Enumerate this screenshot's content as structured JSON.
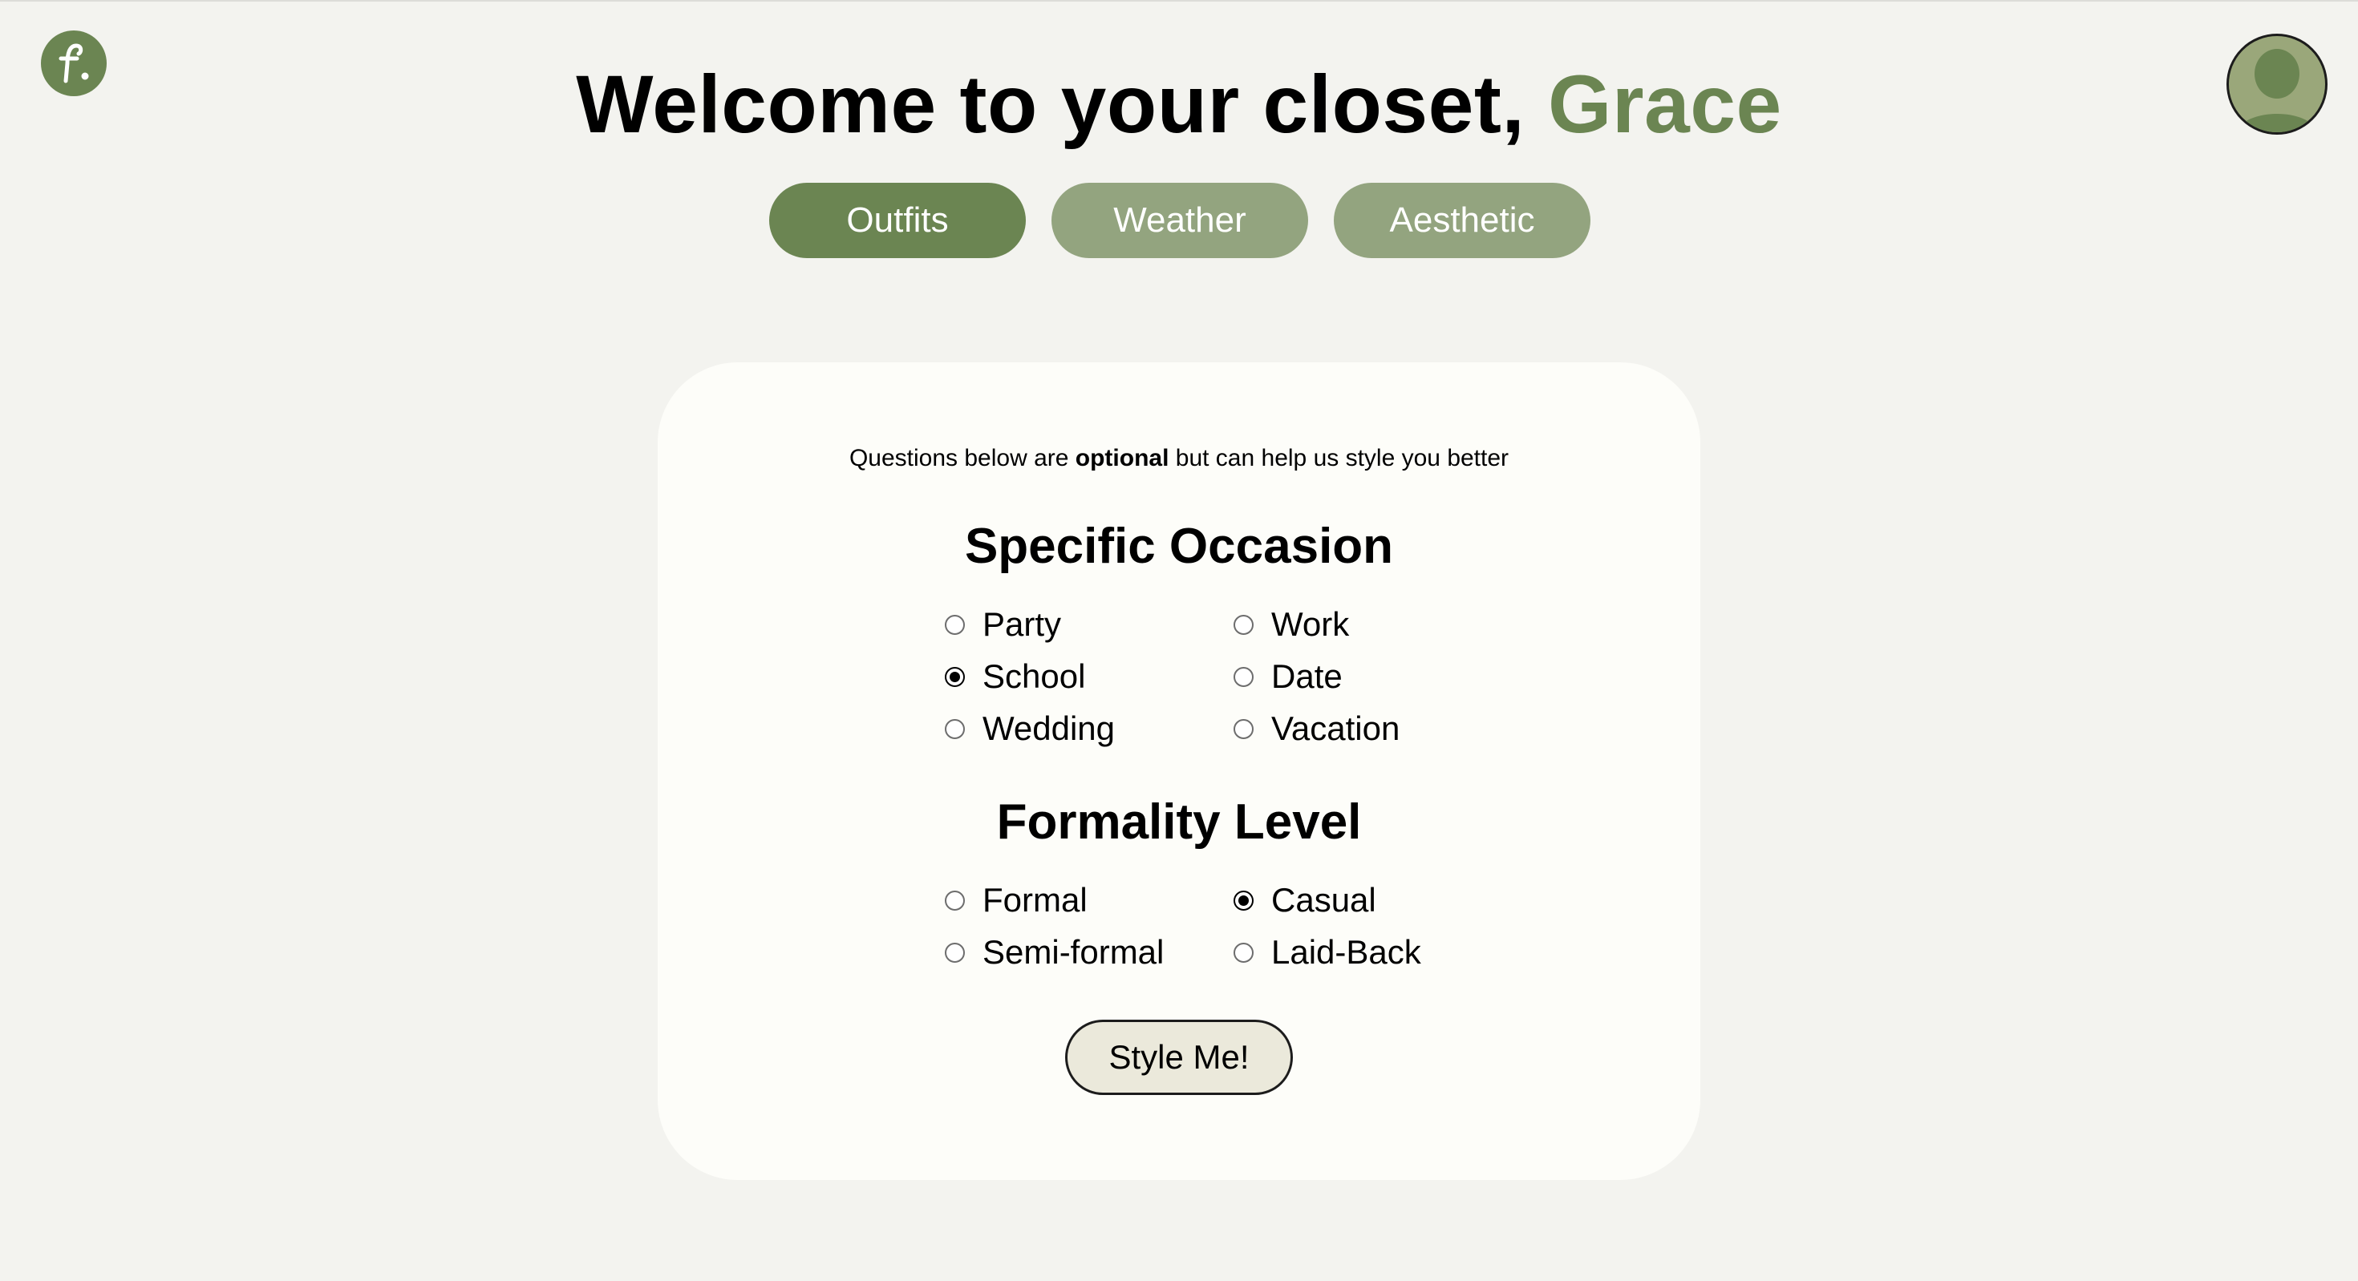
{
  "header": {
    "logo_icon": "brand-logo-icon",
    "title_prefix": "Welcome to your closet, ",
    "user_name": "Grace",
    "avatar_icon": "user-avatar-icon"
  },
  "tabs": [
    {
      "label": "Outfits",
      "active": true
    },
    {
      "label": "Weather",
      "active": false
    },
    {
      "label": "Aesthetic",
      "active": false
    }
  ],
  "form": {
    "note_start": "Questions below are ",
    "note_bold": "optional",
    "note_end": " but can help us style you better",
    "occasion": {
      "title": "Specific Occasion",
      "options": [
        {
          "label": "Party",
          "checked": false
        },
        {
          "label": "Work",
          "checked": false
        },
        {
          "label": "School",
          "checked": true
        },
        {
          "label": "Date",
          "checked": false
        },
        {
          "label": "Wedding",
          "checked": false
        },
        {
          "label": "Vacation",
          "checked": false
        }
      ]
    },
    "formality": {
      "title": "Formality Level",
      "options": [
        {
          "label": "Formal",
          "checked": false
        },
        {
          "label": "Casual",
          "checked": true
        },
        {
          "label": "Semi-formal",
          "checked": false
        },
        {
          "label": "Laid-Back",
          "checked": false
        }
      ]
    },
    "submit_label": "Style Me!"
  },
  "colors": {
    "accent": "#6b8552",
    "tab_inactive": "#93a47f",
    "background": "#f3f3ef",
    "card": "#fdfdf9",
    "button": "#ebe9db"
  }
}
